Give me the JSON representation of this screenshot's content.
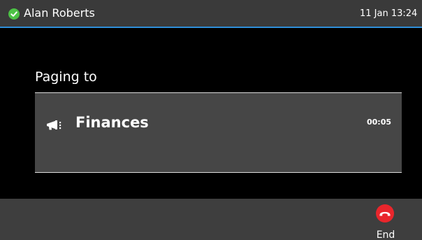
{
  "status_bar": {
    "user_name": "Alan Roberts",
    "presence_icon": "available-check-icon",
    "presence_color": "#4cc245",
    "datetime": "11 Jan 13:24",
    "accent_color": "#2f8fd8"
  },
  "paging": {
    "heading": "Paging to",
    "group_name": "Finances",
    "group_icon": "megaphone-icon",
    "timer": "00:05"
  },
  "softkeys": {
    "end": {
      "label": "End",
      "icon": "hang-up-icon",
      "color": "#e9262c"
    }
  }
}
